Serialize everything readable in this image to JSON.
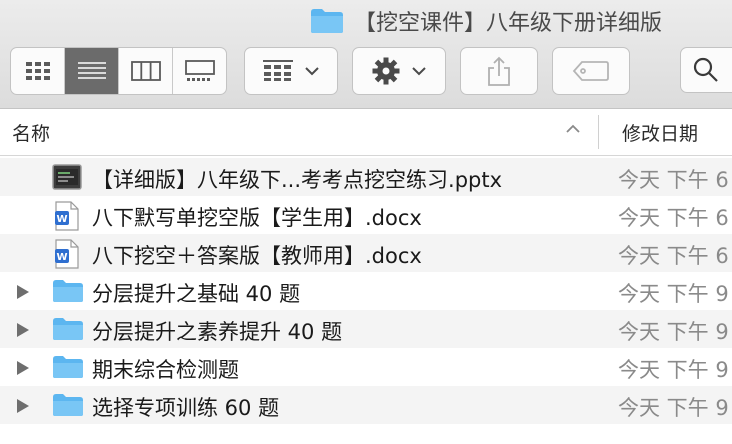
{
  "window": {
    "title": "【挖空课件】八年级下册详细版",
    "title_icon": "folder-icon"
  },
  "toolbar": {
    "view_modes": [
      {
        "name": "icon-view",
        "icon": "grid-3x3-icon",
        "active": false
      },
      {
        "name": "list-view",
        "icon": "list-lines-icon",
        "active": true
      },
      {
        "name": "column-view",
        "icon": "columns-icon",
        "active": false
      },
      {
        "name": "gallery-view",
        "icon": "gallery-icon",
        "active": false
      }
    ],
    "group_icon": "grid-group-icon",
    "action_icon": "gear-icon",
    "share_icon": "share-icon",
    "tag_icon": "tag-icon",
    "search_icon": "search-icon"
  },
  "columns": {
    "name": "名称",
    "date": "修改日期"
  },
  "files": [
    {
      "name": "【详细版】八年级下...考考点挖空练习.pptx",
      "date": "今天 下午 6",
      "kind": "pptx",
      "expandable": false
    },
    {
      "name": "八下默写单挖空版【学生用】.docx",
      "date": "今天 下午 6",
      "kind": "docx",
      "expandable": false
    },
    {
      "name": "八下挖空＋答案版【教师用】.docx",
      "date": "今天 下午 6",
      "kind": "docx",
      "expandable": false
    },
    {
      "name": "分层提升之基础 40 题",
      "date": "今天 下午 9",
      "kind": "folder",
      "expandable": true
    },
    {
      "name": "分层提升之素养提升 40 题",
      "date": "今天 下午 9",
      "kind": "folder",
      "expandable": true
    },
    {
      "name": "期末综合检测题",
      "date": "今天 下午 9",
      "kind": "folder",
      "expandable": true
    },
    {
      "name": "选择专项训练 60 题",
      "date": "今天 下午 9",
      "kind": "folder",
      "expandable": true
    }
  ],
  "colors": {
    "folder": "#5cb6f0",
    "selected_view": "#6b6b6b",
    "row_alt": "#f4f4f4"
  }
}
